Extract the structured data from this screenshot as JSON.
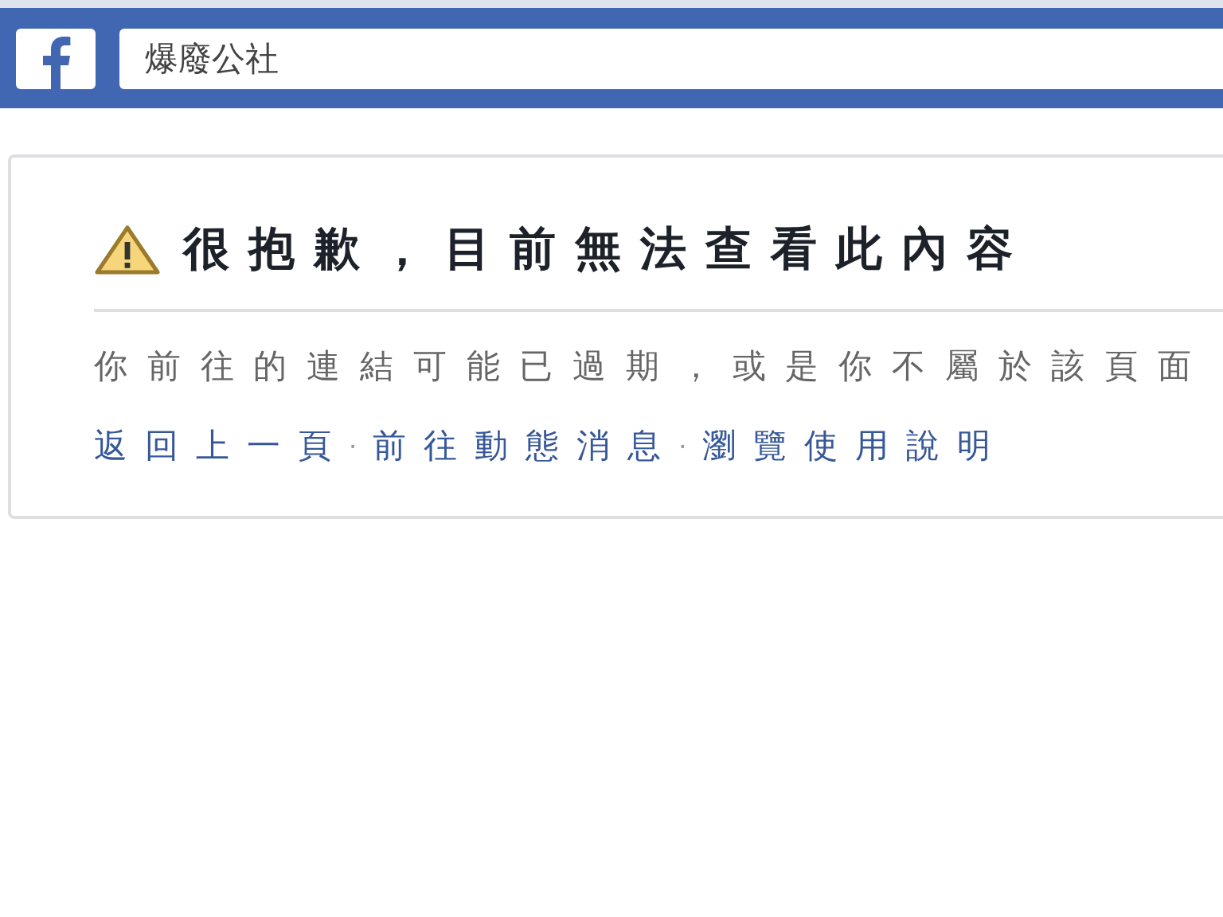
{
  "header": {
    "search": {
      "value": "爆廢公社"
    }
  },
  "notice": {
    "title": "很抱歉，目前無法查看此內容",
    "message": "你前往的連結可能已過期，或是你不屬於該頁面",
    "links": [
      {
        "label": "返回上一頁"
      },
      {
        "label": "前往動態消息"
      },
      {
        "label": "瀏覽使用說明"
      }
    ],
    "separator": "·"
  }
}
